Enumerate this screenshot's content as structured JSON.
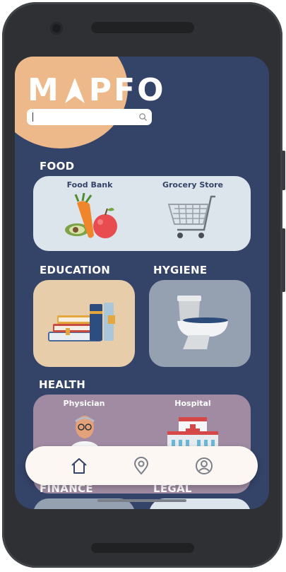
{
  "app": {
    "logo_text_left": "M",
    "logo_text_right": "PFO"
  },
  "search": {
    "value": "",
    "placeholder": ""
  },
  "sections": {
    "food": {
      "title": "FOOD",
      "items": [
        {
          "label": "Food Bank"
        },
        {
          "label": "Grocery Store"
        }
      ]
    },
    "education": {
      "title": "EDUCATION"
    },
    "hygiene": {
      "title": "HYGIENE"
    },
    "health": {
      "title": "HEALTH",
      "items": [
        {
          "label": "Physician"
        },
        {
          "label": "Hospital"
        }
      ]
    },
    "finance": {
      "title": "FINANCE"
    },
    "legal": {
      "title": "LEGAL"
    }
  },
  "navbar": {
    "items": [
      {
        "icon": "home-icon"
      },
      {
        "icon": "map-pin-icon"
      },
      {
        "icon": "profile-icon"
      }
    ]
  },
  "colors": {
    "background": "#344368",
    "accent_blob": "#eeb98a",
    "food_card": "#dce4ec",
    "education_card": "#e7cdaa",
    "hygiene_card": "#95a1b0",
    "health_card": "#a08ba2",
    "navbar": "#fdf7f4"
  }
}
